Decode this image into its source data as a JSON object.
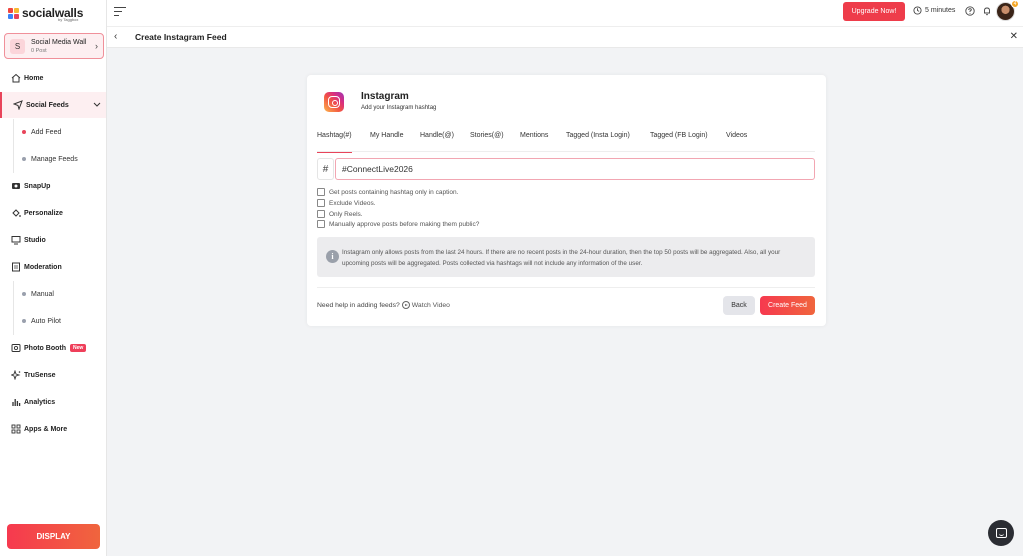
{
  "brand": {
    "name": "socialwalls",
    "sub": "by Taggbox"
  },
  "wall": {
    "avatar": "S",
    "name": "Social Media Wall",
    "post_count": "0 Post"
  },
  "sidebar": {
    "items": [
      {
        "label": "Home",
        "icon": "home-icon"
      },
      {
        "label": "Social Feeds",
        "icon": "share-icon"
      },
      {
        "label": "Add Feed"
      },
      {
        "label": "Manage Feeds"
      },
      {
        "label": "SnapUp",
        "icon": "snapup-icon"
      },
      {
        "label": "Personalize",
        "icon": "paint-bucket-icon"
      },
      {
        "label": "Studio",
        "icon": "monitor-icon"
      },
      {
        "label": "Moderation",
        "icon": "moderation-icon"
      },
      {
        "label": "Manual"
      },
      {
        "label": "Auto Pilot"
      },
      {
        "label": "Photo Booth",
        "icon": "photo-booth-icon",
        "badge": "New"
      },
      {
        "label": "TruSense",
        "icon": "sparkle-icon"
      },
      {
        "label": "Analytics",
        "icon": "bar-chart-icon"
      },
      {
        "label": "Apps & More",
        "icon": "apps-grid-icon"
      }
    ],
    "display_button": "DISPLAY"
  },
  "topbar": {
    "upgrade_label": "Upgrade Now!",
    "timer": "5 minutes",
    "avatar_badge": "4"
  },
  "page": {
    "title": "Create Instagram Feed"
  },
  "card": {
    "title": "Instagram",
    "subtitle": "Add your Instagram hashtag",
    "tabs": [
      "Hashtag(#)",
      "My Handle",
      "Handle(@)",
      "Stories(@)",
      "Mentions",
      "Tagged (Insta Login)",
      "Tagged (FB Login)",
      "Videos"
    ],
    "active_tab": "Hashtag(#)",
    "hash_symbol": "#",
    "hashtag_value": "#ConnectLive2026",
    "checkboxes": [
      "Get posts containing hashtag only in caption.",
      "Exclude Videos.",
      "Only Reels.",
      "Manually approve posts before making them public?"
    ],
    "info_icon_glyph": "i",
    "info_text": "Instagram only allows posts from the last 24 hours. If there are no recent posts in the 24-hour duration, then the top 50 posts will be aggregated. Also, all your upcoming posts will be aggregated. Posts collected via hashtags will not include any information of the user.",
    "help_text": "Need help in adding feeds?",
    "watch_video": "Watch Video",
    "back_label": "Back",
    "create_label": "Create Feed"
  },
  "colors": {
    "accent": "#e8445a",
    "upgrade": "#ee3c4a"
  }
}
